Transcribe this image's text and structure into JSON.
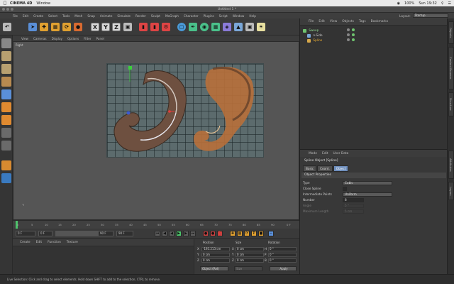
{
  "mac_menu": {
    "app": "CINEMA 4D",
    "items": [
      "Window"
    ],
    "right": {
      "battery": "100%",
      "clock": "Sun 19:32"
    }
  },
  "window_title": "Untitled 1 *",
  "c4d_menu": {
    "items": [
      "File",
      "Edit",
      "Create",
      "Select",
      "Tools",
      "Mesh",
      "Snap",
      "Animate",
      "Simulate",
      "Render",
      "Sculpt",
      "MoGraph",
      "Character",
      "Plugins",
      "Script",
      "Window",
      "Help"
    ],
    "layout_label": "Layout:",
    "layout_value": "Startup"
  },
  "toolbar": {
    "x": "X",
    "y": "Y",
    "z": "Z"
  },
  "viewport": {
    "menu": [
      "View",
      "Cameras",
      "Display",
      "Options",
      "Filter",
      "Panel"
    ],
    "label": "Right"
  },
  "timeline": {
    "ticks": [
      "0",
      "5",
      "10",
      "15",
      "20",
      "25",
      "30",
      "35",
      "40",
      "45",
      "50",
      "55",
      "60",
      "65",
      "70",
      "75",
      "80",
      "85",
      "90"
    ],
    "end": "0 F"
  },
  "transport": {
    "start_field": "0 F",
    "current_field": "0 F",
    "end_field": "90 F",
    "max_field": "90 F"
  },
  "materials": {
    "menu": [
      "Create",
      "Edit",
      "Function",
      "Texture"
    ]
  },
  "coordinates": {
    "headers": [
      "Position",
      "Size",
      "Rotation"
    ],
    "rows": [
      {
        "axis": "X",
        "pos": "-193.213 cm",
        "size": "0 cm",
        "rot": "0 °",
        "size_lbl": "X",
        "rot_lbl": "H"
      },
      {
        "axis": "Y",
        "pos": "0 cm",
        "size": "0 cm",
        "rot": "0 °",
        "size_lbl": "Y",
        "rot_lbl": "P"
      },
      {
        "axis": "Z",
        "pos": "0 cm",
        "size": "0 cm",
        "rot": "0 °",
        "size_lbl": "Z",
        "rot_lbl": "B"
      }
    ],
    "mode": "Object (Rel)",
    "size_mode": "Size",
    "apply": "Apply"
  },
  "status": "Live Selection: Click and drag to select elements. Hold down SHIFT to add to the selection, CTRL to remove.",
  "object_manager": {
    "menu": [
      "File",
      "Edit",
      "View",
      "Objects",
      "Tags",
      "Bookmarks"
    ],
    "objects": [
      {
        "name": "Sweep",
        "color": "#6fc46f"
      },
      {
        "name": "n-Side",
        "color": "#7aa7d8"
      },
      {
        "name": "Spline",
        "color": "#d8a84a"
      }
    ]
  },
  "attribute_manager": {
    "menu": [
      "Mode",
      "Edit",
      "User Data"
    ],
    "object": "Spline Object [Spline]",
    "tabs": [
      "Basic",
      "Coord.",
      "Object"
    ],
    "active_tab": "Object",
    "section": "Object Properties",
    "props": [
      {
        "label": "Type",
        "value": "Cubic",
        "dim": false
      },
      {
        "label": "Close Spline",
        "value": "",
        "dim": false
      },
      {
        "label": "Intermediate Points",
        "value": "Uniform",
        "dim": false
      },
      {
        "label": "Number",
        "value": "8",
        "dim": false
      },
      {
        "label": "Angle",
        "value": "5 °",
        "dim": true
      },
      {
        "label": "Maximum Length",
        "value": "5 cm",
        "dim": true
      }
    ]
  },
  "right_tabs": [
    "Objects",
    "Content Browser",
    "Structure",
    "Attributes",
    "Layers"
  ]
}
